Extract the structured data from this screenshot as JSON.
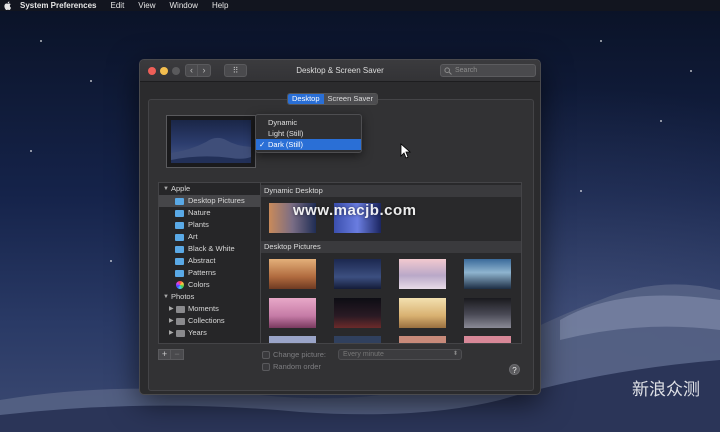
{
  "menubar": {
    "apple_icon": "apple-logo-icon",
    "items": [
      "System Preferences",
      "Edit",
      "View",
      "Window",
      "Help"
    ]
  },
  "window": {
    "title": "Desktop & Screen Saver",
    "search_placeholder": "Search",
    "nav_back": "‹",
    "nav_forward": "›",
    "grid_icon": "⠿"
  },
  "tabs": [
    {
      "label": "Desktop",
      "active": true
    },
    {
      "label": "Screen Saver",
      "active": false
    }
  ],
  "appearance_menu": {
    "items": [
      "Dynamic",
      "Light (Still)",
      "Dark (Still)"
    ],
    "selected": "Dark (Still)"
  },
  "sidebar": {
    "apple_group": "Apple",
    "apple_items": [
      "Desktop Pictures",
      "Nature",
      "Plants",
      "Art",
      "Black & White",
      "Abstract",
      "Patterns",
      "Colors"
    ],
    "selected": "Desktop Pictures",
    "photos_group": "Photos",
    "photos_items": [
      "Moments",
      "Collections",
      "Years"
    ]
  },
  "pane": {
    "section1": "Dynamic Desktop",
    "section2": "Desktop Pictures"
  },
  "bottom": {
    "add": "+",
    "remove": "−",
    "change_picture_label": "Change picture:",
    "change_picture_value": "Every minute",
    "random_order_label": "Random order",
    "help": "?"
  },
  "watermark": "www.macjb.com",
  "brand": "新浪众测",
  "colors": {
    "accent": "#2a6fd6",
    "window_bg": "#2b2b2d"
  }
}
